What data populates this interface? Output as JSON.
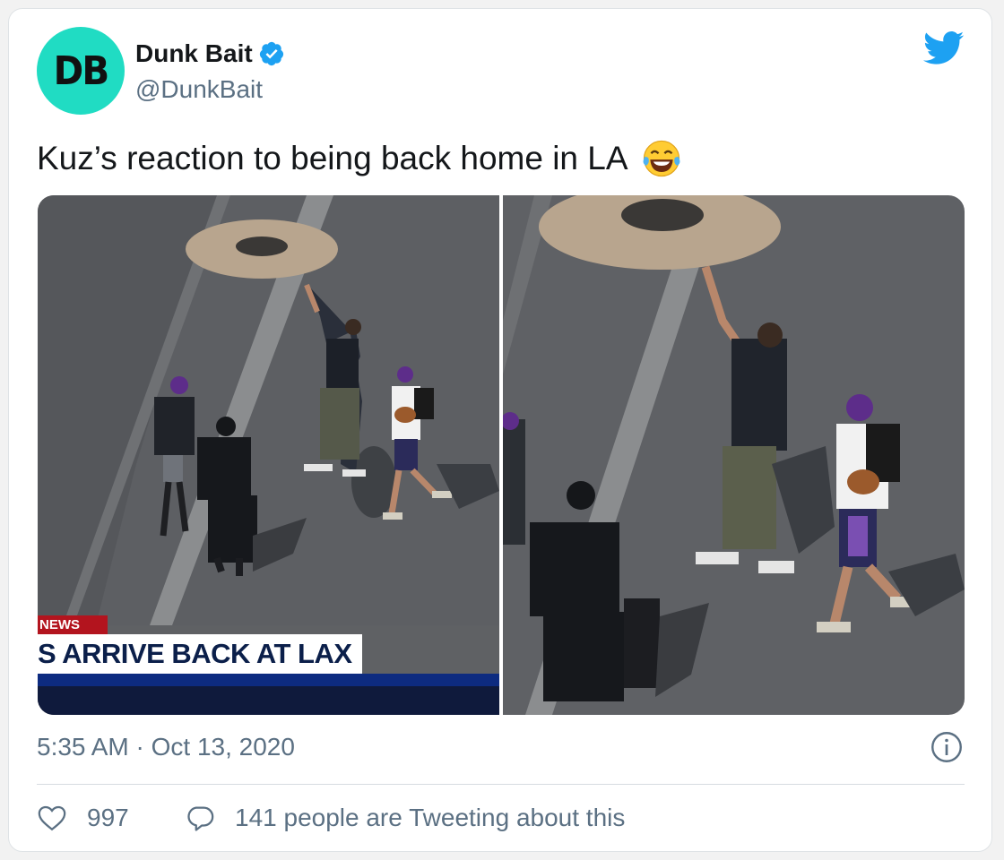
{
  "author": {
    "avatar_initials": "DB",
    "display_name": "Dunk Bait",
    "handle": "@DunkBait",
    "verified": true,
    "avatar_color": "#20dcc3"
  },
  "tweet": {
    "text": "Kuz’s reaction to being back home in LA",
    "emoji": "face-with-tears-of-joy",
    "timestamp": "5:35 AM · Oct 13, 2020"
  },
  "media": {
    "news_tag": "NEWS",
    "headline": "S ARRIVE BACK AT LAX"
  },
  "actions": {
    "like_count": "997",
    "conversation_text": "141 people are Tweeting about this"
  },
  "colors": {
    "accent_blue": "#1da1f2",
    "text_secondary": "#5b7083",
    "news_red": "#b3141e",
    "news_navy": "#0d2b80"
  },
  "icons": [
    "verified-badge-icon",
    "twitter-bird-icon",
    "info-icon",
    "heart-icon",
    "speech-bubble-icon"
  ]
}
